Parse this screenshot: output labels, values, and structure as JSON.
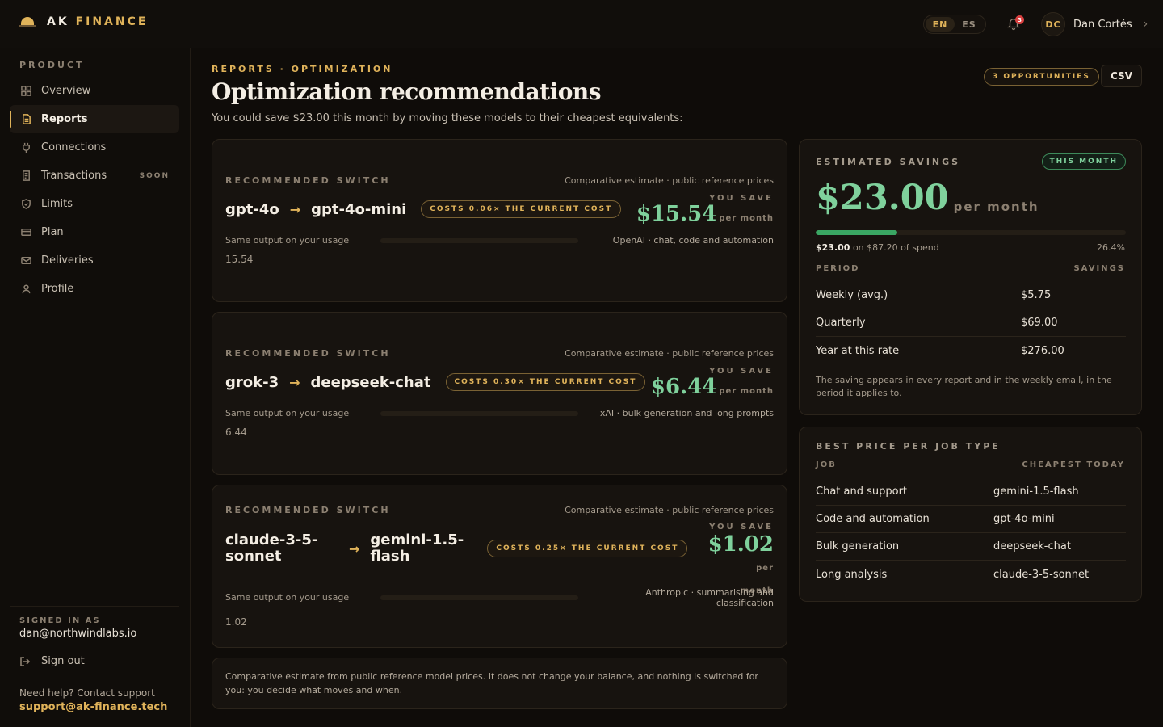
{
  "brand": {
    "name_main": "AK",
    "name_accent": "FINANCE"
  },
  "header": {
    "languages": [
      "EN",
      "ES"
    ],
    "active_language": "EN",
    "notification_count": "3",
    "user_initials": "DC",
    "user_name": "Dan Cortés"
  },
  "sidebar": {
    "section_label": "PRODUCT",
    "items": [
      {
        "label": "Overview",
        "icon": "grid-icon"
      },
      {
        "label": "Reports",
        "icon": "document-icon",
        "active": true
      },
      {
        "label": "Connections",
        "icon": "plug-icon"
      },
      {
        "label": "Transactions",
        "icon": "receipt-icon",
        "badge": "SOON"
      },
      {
        "label": "Limits",
        "icon": "shield-icon"
      },
      {
        "label": "Plan",
        "icon": "card-icon"
      },
      {
        "label": "Deliveries",
        "icon": "mail-icon"
      },
      {
        "label": "Profile",
        "icon": "user-icon"
      }
    ],
    "signed_in_label": "SIGNED IN AS",
    "signed_in_email": "dan@northwindlabs.io",
    "sign_out": "Sign out",
    "help_text": "Need help? Contact support",
    "help_email": "support@ak-finance.tech"
  },
  "page": {
    "breadcrumb": "REPORTS · OPTIMIZATION",
    "title": "Optimization recommendations",
    "subtitle": "You could save $23.00 this month by moving these models to their cheapest equivalents:",
    "opportunities": "3 OPPORTUNITIES",
    "csv_button": "CSV"
  },
  "recommendations": [
    {
      "label": "RECOMMENDED SWITCH",
      "ref": "Comparative estimate · public reference prices",
      "from": "gpt-4o",
      "to": "gpt-4o-mini",
      "cost_ratio": "COSTS 0.06× THE CURRENT COST",
      "save_label": "YOU SAVE",
      "save_amount": "$15.54",
      "per": "per month",
      "same_output": "Same output on your usage",
      "provider": "OpenAI · chat, code and automation",
      "usage_value": "15.54"
    },
    {
      "label": "RECOMMENDED SWITCH",
      "ref": "Comparative estimate · public reference prices",
      "from": "grok-3",
      "to": "deepseek-chat",
      "cost_ratio": "COSTS 0.30× THE CURRENT COST",
      "save_label": "YOU SAVE",
      "save_amount": "$6.44",
      "per": "per month",
      "same_output": "Same output on your usage",
      "provider": "xAI · bulk generation and long prompts",
      "usage_value": "6.44"
    },
    {
      "label": "RECOMMENDED SWITCH",
      "ref": "Comparative estimate · public reference prices",
      "from": "claude-3-5-sonnet",
      "to": "gemini-1.5-flash",
      "cost_ratio": "COSTS 0.25× THE CURRENT COST",
      "save_label": "YOU SAVE",
      "save_amount": "$1.02",
      "per": "per month",
      "same_output": "Same output on your usage",
      "provider": "Anthropic · summarising and classification",
      "usage_value": "1.02"
    }
  ],
  "disclaimer": "Comparative estimate from public reference model prices. It does not change your balance, and nothing is switched for you: you decide what moves and when.",
  "savings": {
    "label": "ESTIMATED SAVINGS",
    "badge": "THIS MONTH",
    "amount": "$23.00",
    "per": "per month",
    "progress_fraction": 0.264,
    "saved": "$23.00",
    "of_spend": "on $87.20 of spend",
    "percent": "26.4%",
    "col_period": "PERIOD",
    "col_savings": "SAVINGS",
    "rows": [
      {
        "period": "Weekly (avg.)",
        "value": "$5.75"
      },
      {
        "period": "Quarterly",
        "value": "$69.00"
      },
      {
        "period": "Year at this rate",
        "value": "$276.00"
      }
    ],
    "note": "The saving appears in every report and in the weekly email, in the period it applies to."
  },
  "best_price": {
    "label": "BEST PRICE PER JOB TYPE",
    "col_job": "JOB",
    "col_cheapest": "CHEAPEST TODAY",
    "rows": [
      {
        "job": "Chat and support",
        "model": "gemini-1.5-flash"
      },
      {
        "job": "Code and automation",
        "model": "gpt-4o-mini"
      },
      {
        "job": "Bulk generation",
        "model": "deepseek-chat"
      },
      {
        "job": "Long analysis",
        "model": "claude-3-5-sonnet"
      }
    ]
  },
  "colors": {
    "accent": "#e0b35a",
    "positive": "#7fd19c",
    "background": "#0f0c09"
  }
}
